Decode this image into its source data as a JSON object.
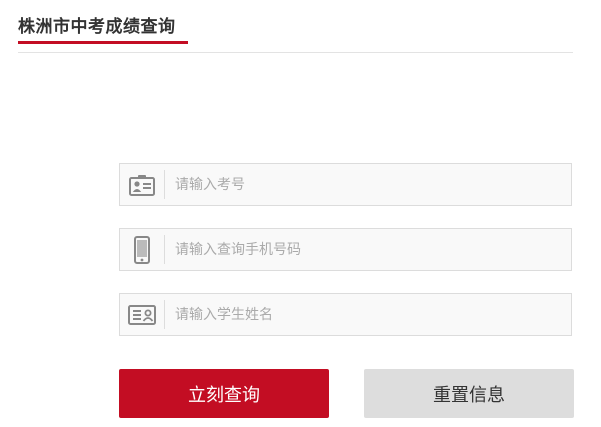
{
  "header": {
    "title": "株洲市中考成绩查询"
  },
  "form": {
    "exam_number": {
      "placeholder": "请输入考号",
      "value": "",
      "icon": "id-badge-icon"
    },
    "phone": {
      "placeholder": "请输入查询手机号码",
      "value": "",
      "icon": "mobile-phone-icon"
    },
    "student_name": {
      "placeholder": "请输入学生姓名",
      "value": "",
      "icon": "name-card-icon"
    }
  },
  "actions": {
    "query_label": "立刻查询",
    "reset_label": "重置信息"
  },
  "colors": {
    "accent": "#c30d23",
    "secondary_button": "#dddddd",
    "icon": "#888888"
  }
}
